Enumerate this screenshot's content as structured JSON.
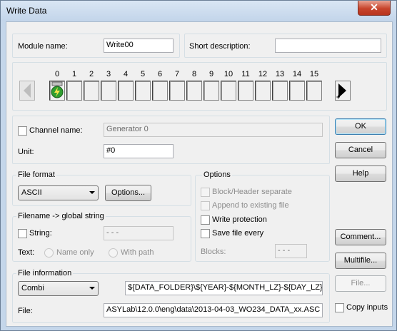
{
  "window": {
    "title": "Write Data",
    "close_glyph": "✕"
  },
  "module": {
    "name_label": "Module name:",
    "name_value": "Write00",
    "short_desc_label": "Short description:",
    "short_desc_value": ""
  },
  "channels": {
    "numbers": [
      "0",
      "1",
      "2",
      "3",
      "4",
      "5",
      "6",
      "7",
      "8",
      "9",
      "10",
      "11",
      "12",
      "13",
      "14",
      "15"
    ],
    "connected_channel": "0",
    "connected_icon": "green-generator-icon",
    "prev_icon": "arrow-left-icon",
    "next_icon": "arrow-right-icon"
  },
  "channel_name": {
    "label": "Channel name:",
    "value": "Generator 0",
    "checked": false
  },
  "unit": {
    "label": "Unit:",
    "value": "#0"
  },
  "file_format": {
    "legend": "File format",
    "selected": "ASCII",
    "options_label": "Options..."
  },
  "filename_string": {
    "legend": "Filename -> global string",
    "string_label": "String:",
    "string_value": "- - -",
    "text_label": "Text:",
    "name_only": "Name only",
    "with_path": "With path"
  },
  "options": {
    "legend": "Options",
    "block_header": "Block/Header separate",
    "append": "Append to existing file",
    "write_protection": "Write protection",
    "save_every": "Save file every",
    "blocks_label": "Blocks:",
    "blocks_value": "- - -"
  },
  "file_info": {
    "legend": "File information",
    "selected": "Combi",
    "pattern": "${DATA_FOLDER}\\${YEAR}-${MONTH_LZ}-${DAY_LZ}",
    "file_label": "File:",
    "file_value": "ASYLab\\12.0.0\\eng\\data\\2013-04-03_WO234_DATA_xx.ASC"
  },
  "buttons": {
    "ok": "OK",
    "cancel": "Cancel",
    "help": "Help",
    "comment": "Comment...",
    "multifile": "Multifile...",
    "file": "File..."
  },
  "copy_inputs": {
    "label": "Copy inputs",
    "checked": false
  }
}
